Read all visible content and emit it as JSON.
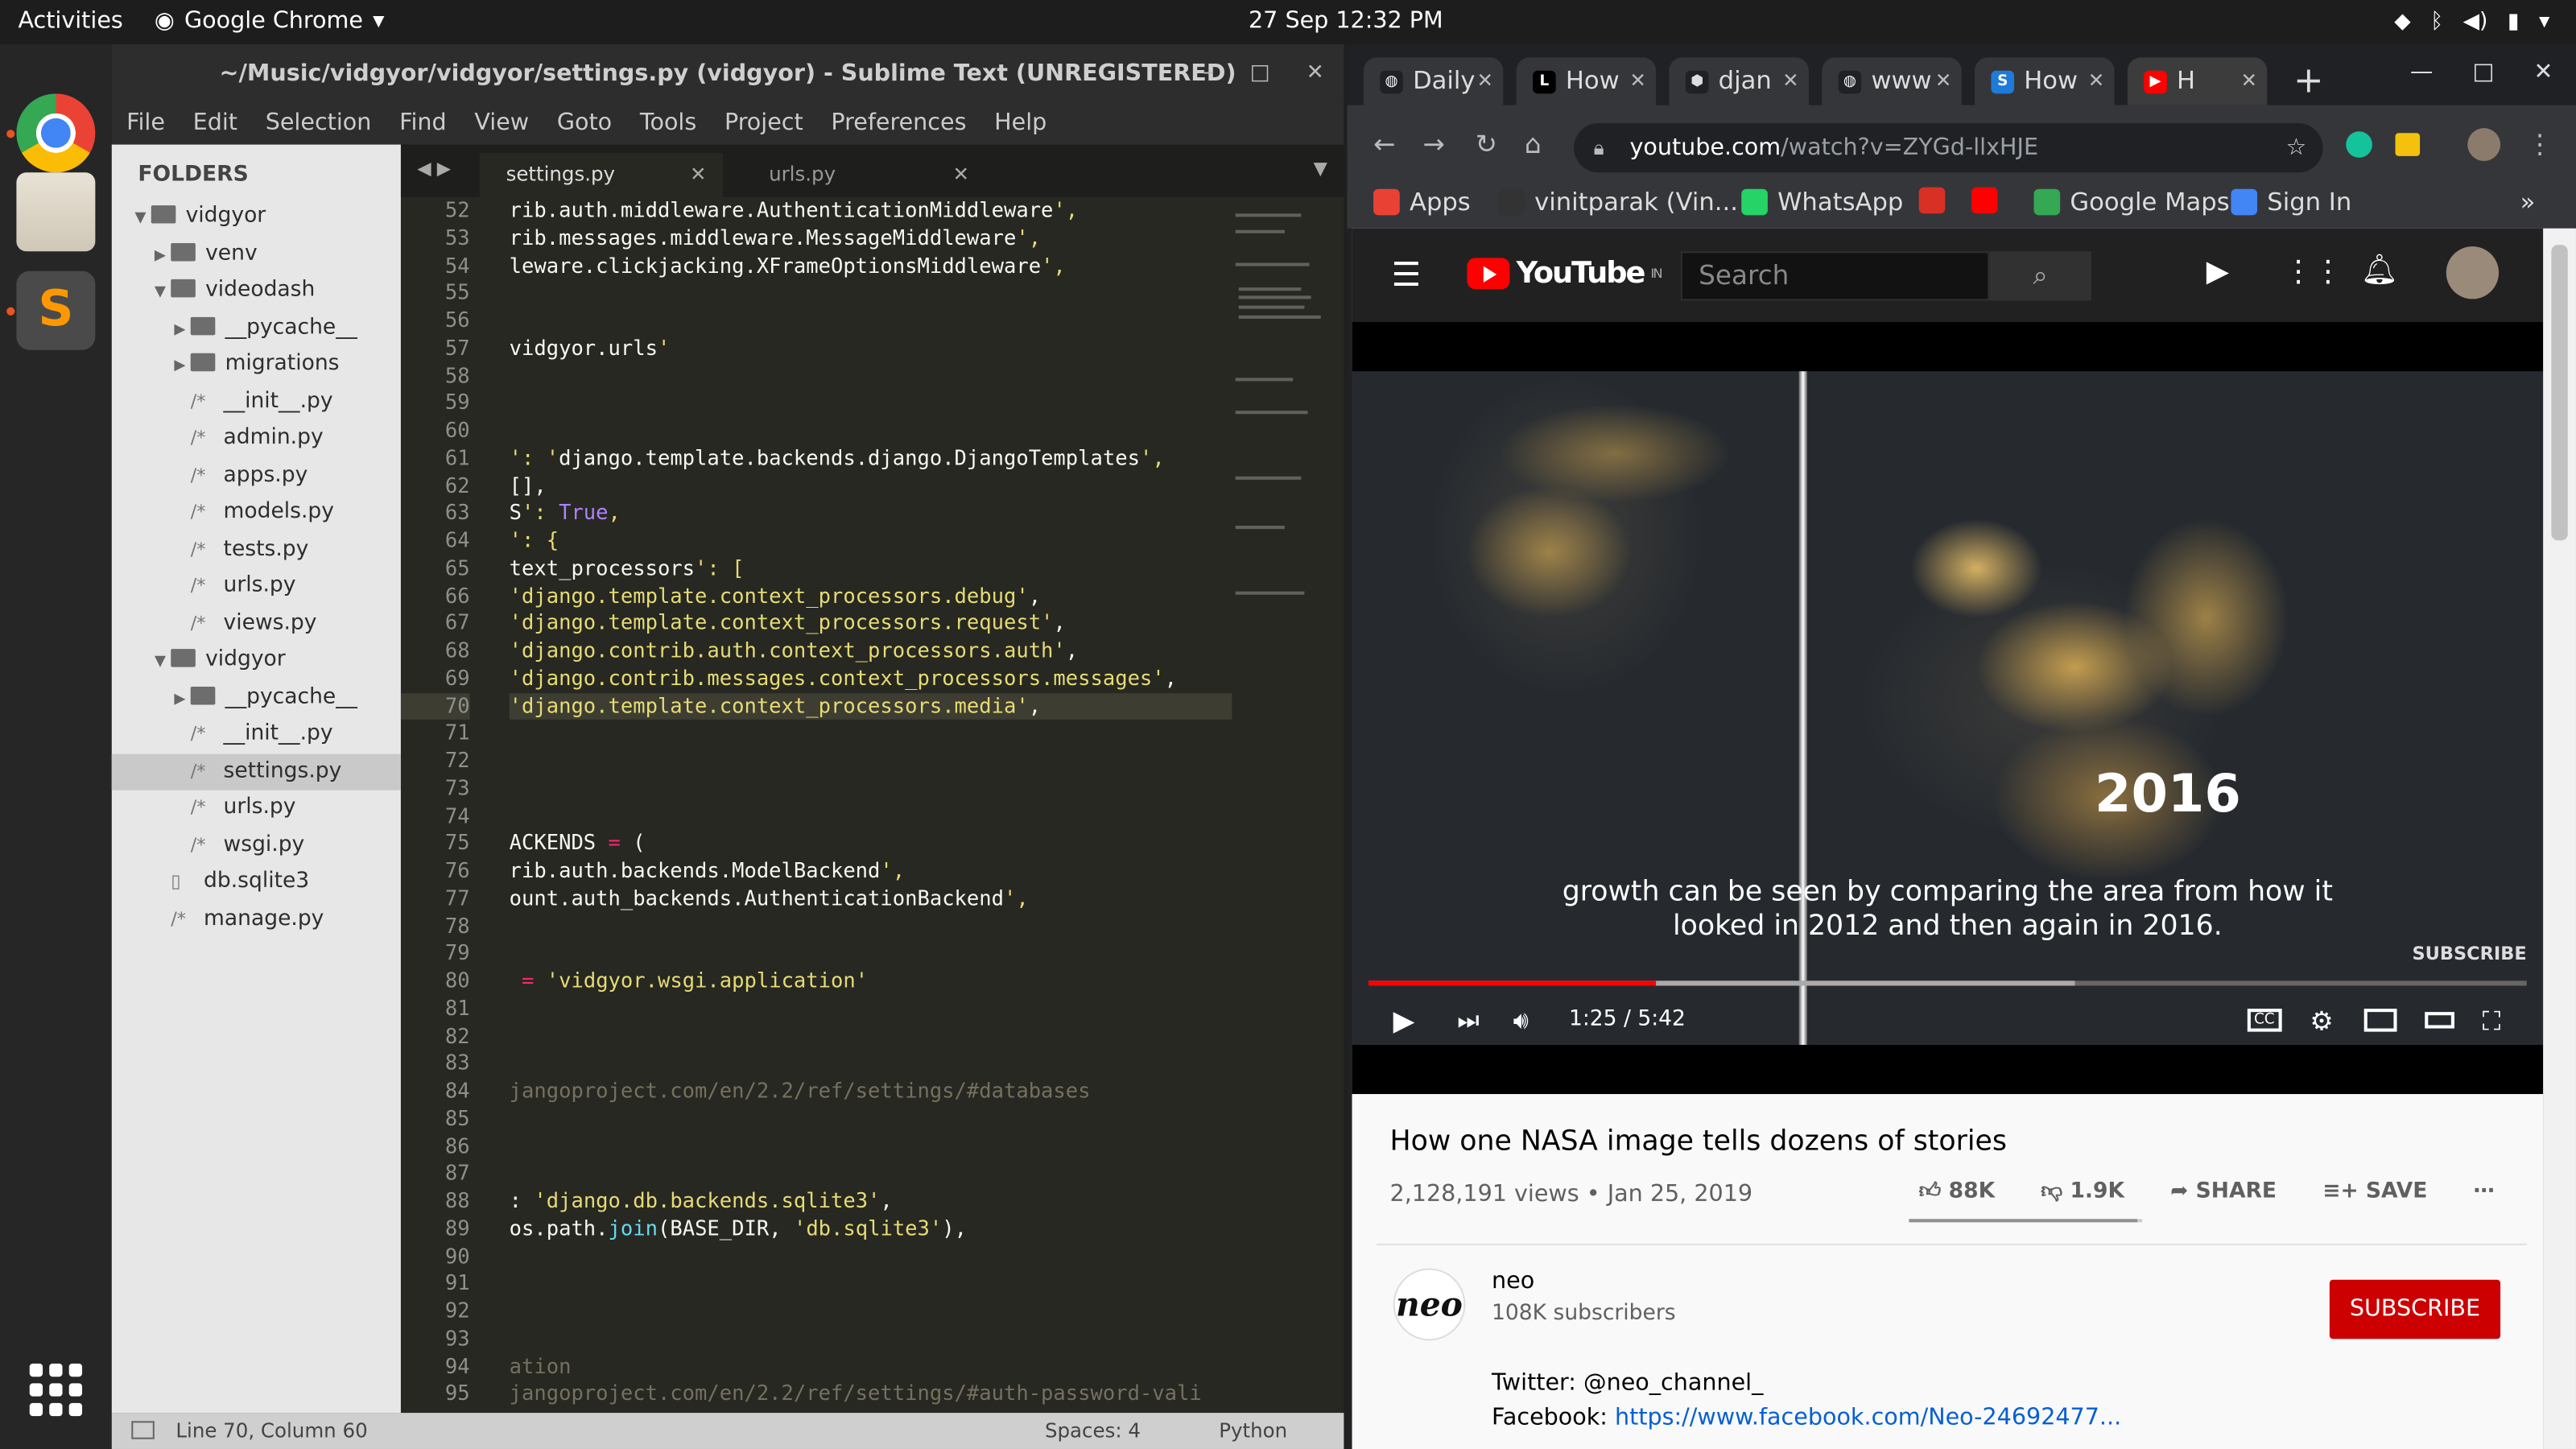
{
  "topbar": {
    "activities": "Activities",
    "app_name": "Google Chrome",
    "datetime": "27 Sep  12:32 PM"
  },
  "sublime": {
    "title": "~/Music/vidgyor/vidgyor/settings.py (vidgyor) - Sublime Text (UNREGISTERED)",
    "menu": [
      "File",
      "Edit",
      "Selection",
      "Find",
      "View",
      "Goto",
      "Tools",
      "Project",
      "Preferences",
      "Help"
    ],
    "folders_header": "FOLDERS",
    "tree": [
      {
        "name": "vidgyor",
        "type": "folder",
        "open": true,
        "depth": 0
      },
      {
        "name": "venv",
        "type": "folder",
        "open": false,
        "depth": 1
      },
      {
        "name": "videodash",
        "type": "folder",
        "open": true,
        "depth": 1
      },
      {
        "name": "__pycache__",
        "type": "folder",
        "open": false,
        "depth": 2
      },
      {
        "name": "migrations",
        "type": "folder",
        "open": false,
        "depth": 2
      },
      {
        "name": "__init__.py",
        "type": "file",
        "depth": 2
      },
      {
        "name": "admin.py",
        "type": "file",
        "depth": 2
      },
      {
        "name": "apps.py",
        "type": "file",
        "depth": 2
      },
      {
        "name": "models.py",
        "type": "file",
        "depth": 2
      },
      {
        "name": "tests.py",
        "type": "file",
        "depth": 2
      },
      {
        "name": "urls.py",
        "type": "file",
        "depth": 2
      },
      {
        "name": "views.py",
        "type": "file",
        "depth": 2
      },
      {
        "name": "vidgyor",
        "type": "folder",
        "open": true,
        "depth": 1
      },
      {
        "name": "__pycache__",
        "type": "folder",
        "open": false,
        "depth": 2
      },
      {
        "name": "__init__.py",
        "type": "file",
        "depth": 2
      },
      {
        "name": "settings.py",
        "type": "file",
        "depth": 2,
        "selected": true
      },
      {
        "name": "urls.py",
        "type": "file",
        "depth": 2
      },
      {
        "name": "wsgi.py",
        "type": "file",
        "depth": 2
      },
      {
        "name": "db.sqlite3",
        "type": "plain",
        "depth": 1
      },
      {
        "name": "manage.py",
        "type": "file",
        "depth": 1
      }
    ],
    "tabs": [
      {
        "label": "settings.py",
        "active": true
      },
      {
        "label": "urls.py",
        "active": false
      }
    ],
    "line_numbers": [
      52,
      53,
      54,
      55,
      56,
      57,
      58,
      59,
      60,
      61,
      62,
      63,
      64,
      65,
      66,
      67,
      68,
      69,
      70,
      71,
      72,
      73,
      74,
      75,
      76,
      77,
      78,
      79,
      80,
      81,
      82,
      83,
      84,
      85,
      86,
      87,
      88,
      89,
      90,
      91,
      92,
      93,
      94,
      95
    ],
    "current_line": 70,
    "code_lines": [
      "rib.auth.middleware.AuthenticationMiddleware',",
      "rib.messages.middleware.MessageMiddleware',",
      "leware.clickjacking.XFrameOptionsMiddleware',",
      "",
      "",
      "vidgyor.urls'",
      "",
      "",
      "",
      "': 'django.template.backends.django.DjangoTemplates',",
      "[],",
      "S': True,",
      "': {",
      "text_processors': [",
      "'django.template.context_processors.debug',",
      "'django.template.context_processors.request',",
      "'django.contrib.auth.context_processors.auth',",
      "'django.contrib.messages.context_processors.messages',",
      "'django.template.context_processors.media',",
      "",
      "",
      "",
      "",
      "ACKENDS = (",
      "rib.auth.backends.ModelBackend',",
      "ount.auth_backends.AuthenticationBackend',",
      "",
      "",
      " = 'vidgyor.wsgi.application'",
      "",
      "",
      "",
      "jangoproject.com/en/2.2/ref/settings/#databases",
      "",
      "",
      "",
      ": 'django.db.backends.sqlite3',",
      "os.path.join(BASE_DIR, 'db.sqlite3'),",
      "",
      "",
      "",
      "",
      "ation",
      "jangoproject.com/en/2.2/ref/settings/#auth-password-vali"
    ],
    "status": {
      "position": "Line 70, Column 60",
      "spaces": "Spaces: 4",
      "syntax": "Python"
    }
  },
  "chrome": {
    "tabs": [
      {
        "label": "Daily",
        "icon": "globe-icon"
      },
      {
        "label": "How",
        "icon": "l-logo-icon"
      },
      {
        "label": "djan",
        "icon": "cube-icon"
      },
      {
        "label": "www",
        "icon": "globe-icon"
      },
      {
        "label": "How",
        "icon": "s-logo-icon"
      },
      {
        "label": "H",
        "icon": "youtube-icon",
        "active": true
      }
    ],
    "url_host": "youtube.com",
    "url_path": "/watch?v=ZYGd-llxHJE",
    "bookmarks": [
      "Apps",
      "vinitparak (Vin...",
      "WhatsApp",
      "Google Maps",
      "Sign In"
    ],
    "bookmark_more": "»"
  },
  "youtube": {
    "logo_text": "YouTube",
    "region": "IN",
    "search_placeholder": "Search",
    "video": {
      "overlay_year": "2016",
      "caption": "growth can be seen by comparing the area from how it looked in 2012 and then again in 2016.",
      "subscribe_watermark": "SUBSCRIBE",
      "time": "1:25 / 5:42",
      "played_fraction": 0.248
    },
    "title": "How one NASA image tells dozens of stories",
    "stats": "2,128,191 views • Jan 25, 2019",
    "likes": "88K",
    "dislikes": "1.9K",
    "like_fraction": 0.979,
    "share": "SHARE",
    "save": "SAVE",
    "channel": {
      "name": "neo",
      "subscribers": "108K subscribers",
      "avatar_text": "neo"
    },
    "subscribe_button": "SUBSCRIBE",
    "desc_twitter": "Twitter: @neo_channel_",
    "desc_facebook_label": "Facebook: ",
    "desc_facebook_link": "https://www.facebook.com/Neo-24692477..."
  },
  "colors": {
    "youtube_red": "#ff0000",
    "subscribe_red": "#cc0000",
    "sublime_bg": "#272822",
    "sidebar_bg": "#e7e7e7"
  }
}
